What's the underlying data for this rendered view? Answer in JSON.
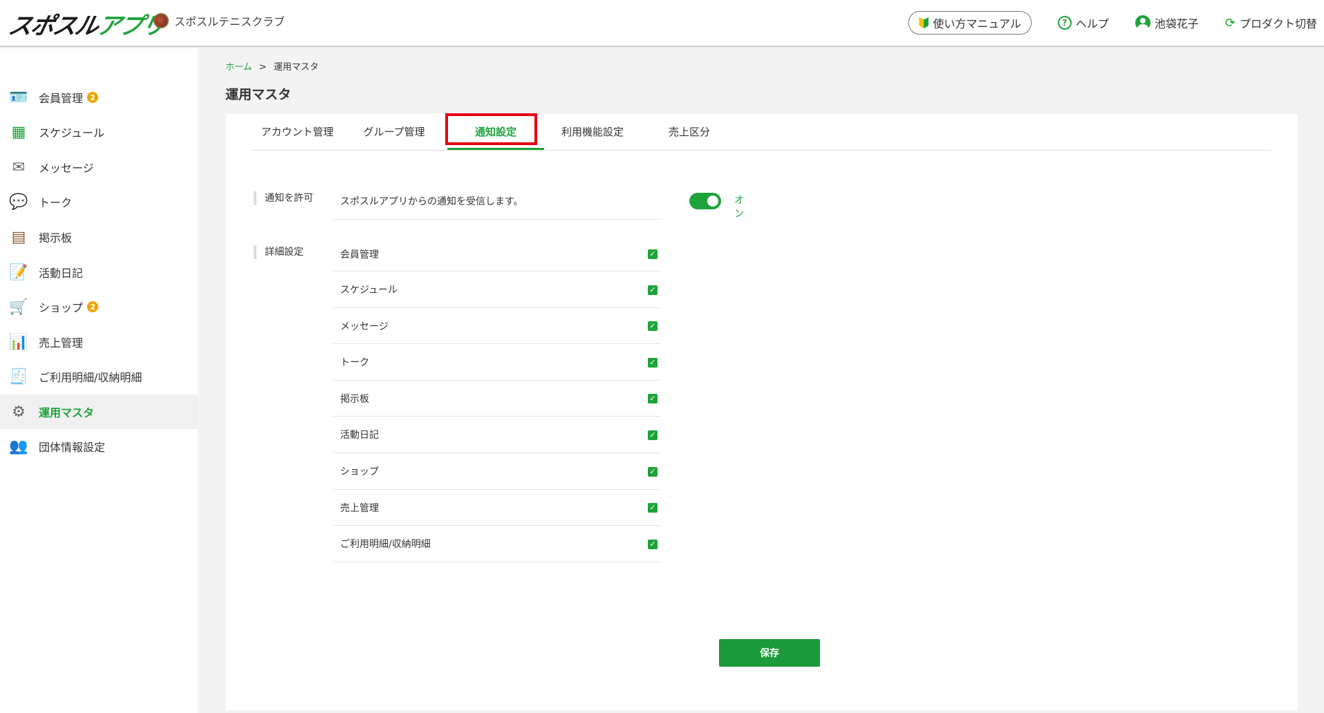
{
  "header": {
    "logo_text_a": "スポスル",
    "logo_text_b": "アプリ",
    "club_name": "スポスルテニスクラブ",
    "manual": "使い方マニュアル",
    "help": "ヘルプ",
    "user": "池袋花子",
    "switch": "プロダクト切替"
  },
  "sidebar": {
    "items": [
      {
        "label": "会員管理",
        "badge": "2"
      },
      {
        "label": "スケジュール"
      },
      {
        "label": "メッセージ"
      },
      {
        "label": "トーク"
      },
      {
        "label": "掲示板"
      },
      {
        "label": "活動日記"
      },
      {
        "label": "ショップ",
        "badge": "2"
      },
      {
        "label": "売上管理"
      },
      {
        "label": "ご利用明細/収納明細"
      },
      {
        "label": "運用マスタ"
      },
      {
        "label": "団体情報設定"
      }
    ]
  },
  "breadcrumb": {
    "home": "ホーム",
    "sep": ">",
    "current": "運用マスタ"
  },
  "page_title": "運用マスタ",
  "tabs": [
    {
      "label": "アカウント管理"
    },
    {
      "label": "グループ管理"
    },
    {
      "label": "通知設定"
    },
    {
      "label": "利用機能設定"
    },
    {
      "label": "売上区分"
    }
  ],
  "notify": {
    "label": "通知を許可",
    "description": "スポスルアプリからの通知を受信します。",
    "state": "オン"
  },
  "details": {
    "label": "詳細設定",
    "items": [
      "会員管理",
      "スケジュール",
      "メッセージ",
      "トーク",
      "掲示板",
      "活動日記",
      "ショップ",
      "売上管理",
      "ご利用明細/収納明細"
    ]
  },
  "save_label": "保存",
  "colors": {
    "accent": "#1ea33a",
    "highlight": "#e60012",
    "badge": "#f0a400"
  }
}
